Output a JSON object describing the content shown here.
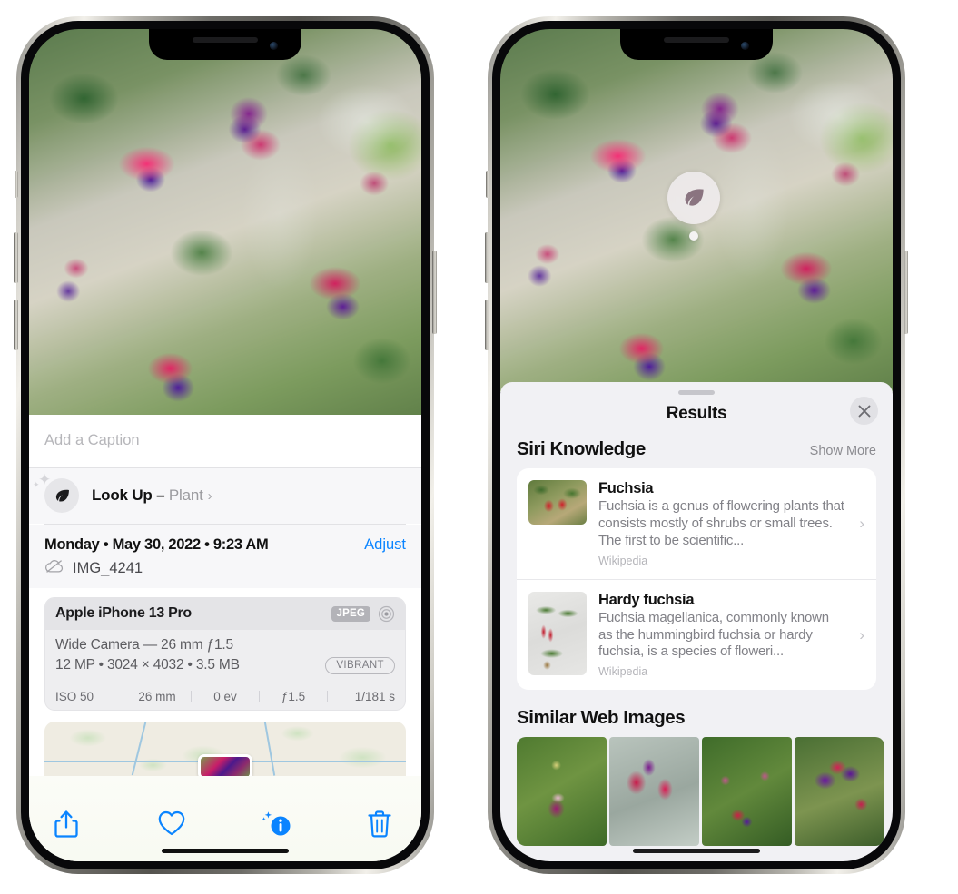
{
  "left_phone": {
    "caption_placeholder": "Add a Caption",
    "lookup": {
      "label": "Look Up – ",
      "subject": "Plant",
      "chevron": "›",
      "icon": "leaf-icon"
    },
    "date": "Monday • May 30, 2022 • 9:23 AM",
    "adjust_label": "Adjust",
    "filename": "IMG_4241",
    "camera_card": {
      "device": "Apple iPhone 13 Pro",
      "format_badge": "JPEG",
      "lens": "Wide Camera — 26 mm ƒ1.5",
      "resolution": "12 MP • 3024 × 4032 • 3.5 MB",
      "style_badge": "VIBRANT",
      "exif": [
        "ISO 50",
        "26 mm",
        "0 ev",
        "ƒ1.5",
        "1/181 s"
      ]
    },
    "toolbar": {
      "share": "share-icon",
      "favorite": "heart-icon",
      "info": "info-icon",
      "delete": "trash-icon"
    }
  },
  "right_phone": {
    "sheet_title": "Results",
    "close_label": "✕",
    "siri_section": {
      "title": "Siri Knowledge",
      "show_more": "Show More",
      "items": [
        {
          "title": "Fuchsia",
          "description": "Fuchsia is a genus of flowering plants that consists mostly of shrubs or small trees. The first to be scientific...",
          "source": "Wikipedia",
          "chevron": "›"
        },
        {
          "title": "Hardy fuchsia",
          "description": "Fuchsia magellanica, commonly known as the hummingbird fuchsia or hardy fuchsia, is a species of floweri...",
          "source": "Wikipedia",
          "chevron": "›"
        }
      ]
    },
    "web_section": {
      "title": "Similar Web Images",
      "images": [
        "fuchsia-web-image-1",
        "fuchsia-web-image-2",
        "fuchsia-web-image-3",
        "fuchsia-web-image-4"
      ]
    },
    "leaf_badge": "leaf-badge-icon"
  },
  "colors": {
    "accent_blue": "#0a84ff",
    "sheet_bg": "#f1f1f4",
    "card_bg": "#ffffff"
  }
}
